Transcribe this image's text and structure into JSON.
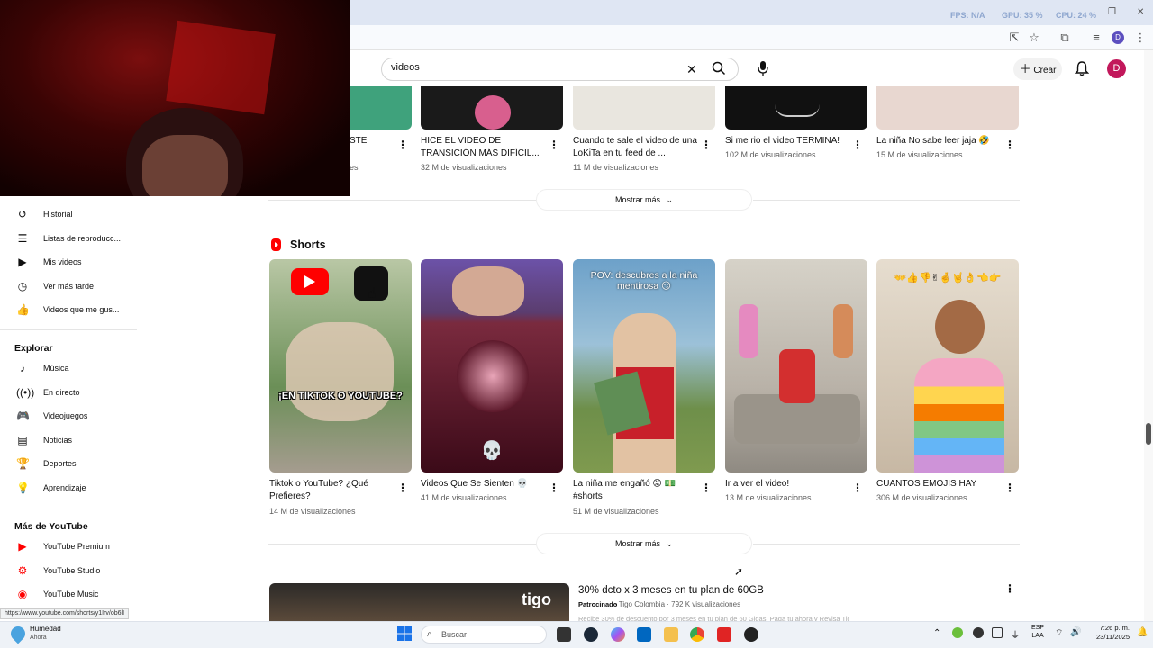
{
  "browser": {
    "perf": {
      "fps": "FPS: N/A",
      "gpu": "GPU: 35 %",
      "cpu": "CPU: 24 %"
    }
  },
  "header": {
    "search_value": "videos",
    "create_label": "Crear",
    "avatar_letter": "D"
  },
  "sidebar": {
    "you_items": [
      {
        "label": "Historial",
        "icon": "history-icon"
      },
      {
        "label": "Listas de reproducc...",
        "icon": "playlist-icon"
      },
      {
        "label": "Mis videos",
        "icon": "my-videos-icon"
      },
      {
        "label": "Ver más tarde",
        "icon": "watch-later-icon"
      },
      {
        "label": "Videos que me gus...",
        "icon": "like-icon"
      }
    ],
    "explore_title": "Explorar",
    "explore_items": [
      {
        "label": "Música",
        "icon": "music-icon"
      },
      {
        "label": "En directo",
        "icon": "live-icon"
      },
      {
        "label": "Videojuegos",
        "icon": "gaming-icon"
      },
      {
        "label": "Noticias",
        "icon": "news-icon"
      },
      {
        "label": "Deportes",
        "icon": "sports-icon"
      },
      {
        "label": "Aprendizaje",
        "icon": "learning-icon"
      }
    ],
    "more_title": "Más de YouTube",
    "more_items": [
      {
        "label": "YouTube Premium",
        "icon": "yt-premium-icon"
      },
      {
        "label": "YouTube Studio",
        "icon": "yt-studio-icon"
      },
      {
        "label": "YouTube Music",
        "icon": "yt-music-icon"
      }
    ]
  },
  "top_row": [
    {
      "title": "STE",
      "meta": "es"
    },
    {
      "title": "HICE EL VIDEO DE TRANSICIÓN MÁS DIFÍCIL...",
      "meta": "32 M de visualizaciones"
    },
    {
      "title": "Cuando te sale el video de una LoKiTa en tu feed de ...",
      "meta": "11 M de visualizaciones"
    },
    {
      "title": "Si me rio el video TERMINA!",
      "meta": "102 M de visualizaciones"
    },
    {
      "title": "La niña No sabe leer jaja 🤣",
      "meta": "15 M de visualizaciones"
    }
  ],
  "show_more_label": "Mostrar más",
  "shorts": {
    "section_title": "Shorts",
    "items": [
      {
        "title": "Tiktok o YouTube? ¿Qué Prefieres?",
        "meta": "14 M de visualizaciones",
        "overlay": "¡EN TIKTOK O YOUTUBE?",
        "color": "#6b8f57"
      },
      {
        "title": "Videos Que Se Sienten 💀",
        "meta": "41 M de visualizaciones",
        "overlay": "💀",
        "color": "#7a2a3e"
      },
      {
        "title": "La niña me engañó 😡 💵 #shorts",
        "meta": "51 M de visualizaciones",
        "overlay": "POV: descubres a la niña mentirosa 😏",
        "color": "#6da1c9"
      },
      {
        "title": "Ir a ver el video!",
        "meta": "13 M de visualizaciones",
        "overlay": "",
        "color": "#b9b2a8"
      },
      {
        "title": "CUANTOS EMOJIS HAY",
        "meta": "306 M de visualizaciones",
        "overlay": "👐👍👎✌🤞🤘👌👈👉",
        "color": "#c7b8a4"
      }
    ]
  },
  "ad": {
    "title": "30% dcto x 3 meses en tu plan de 60GB",
    "sponsor": "Patrocinado",
    "channel": "· Tigo Colombia · 792 K visualizaciones",
    "desc": "Recibe 30% de descuento por 3 meses en tu plan de 60 Gigas. Paga tu ahora y Revisa Tigo...",
    "brand": "tigo"
  },
  "status_url": "https://www.youtube.com/shorts/y1Irv/ob6lI",
  "taskbar": {
    "weather_label": "Humedad",
    "weather_sub": "Ahora",
    "search_placeholder": "Buscar",
    "lang": "ESP",
    "lang_sub": "LAA",
    "time": "7:26 p. m.",
    "date": "23/11/2025"
  }
}
